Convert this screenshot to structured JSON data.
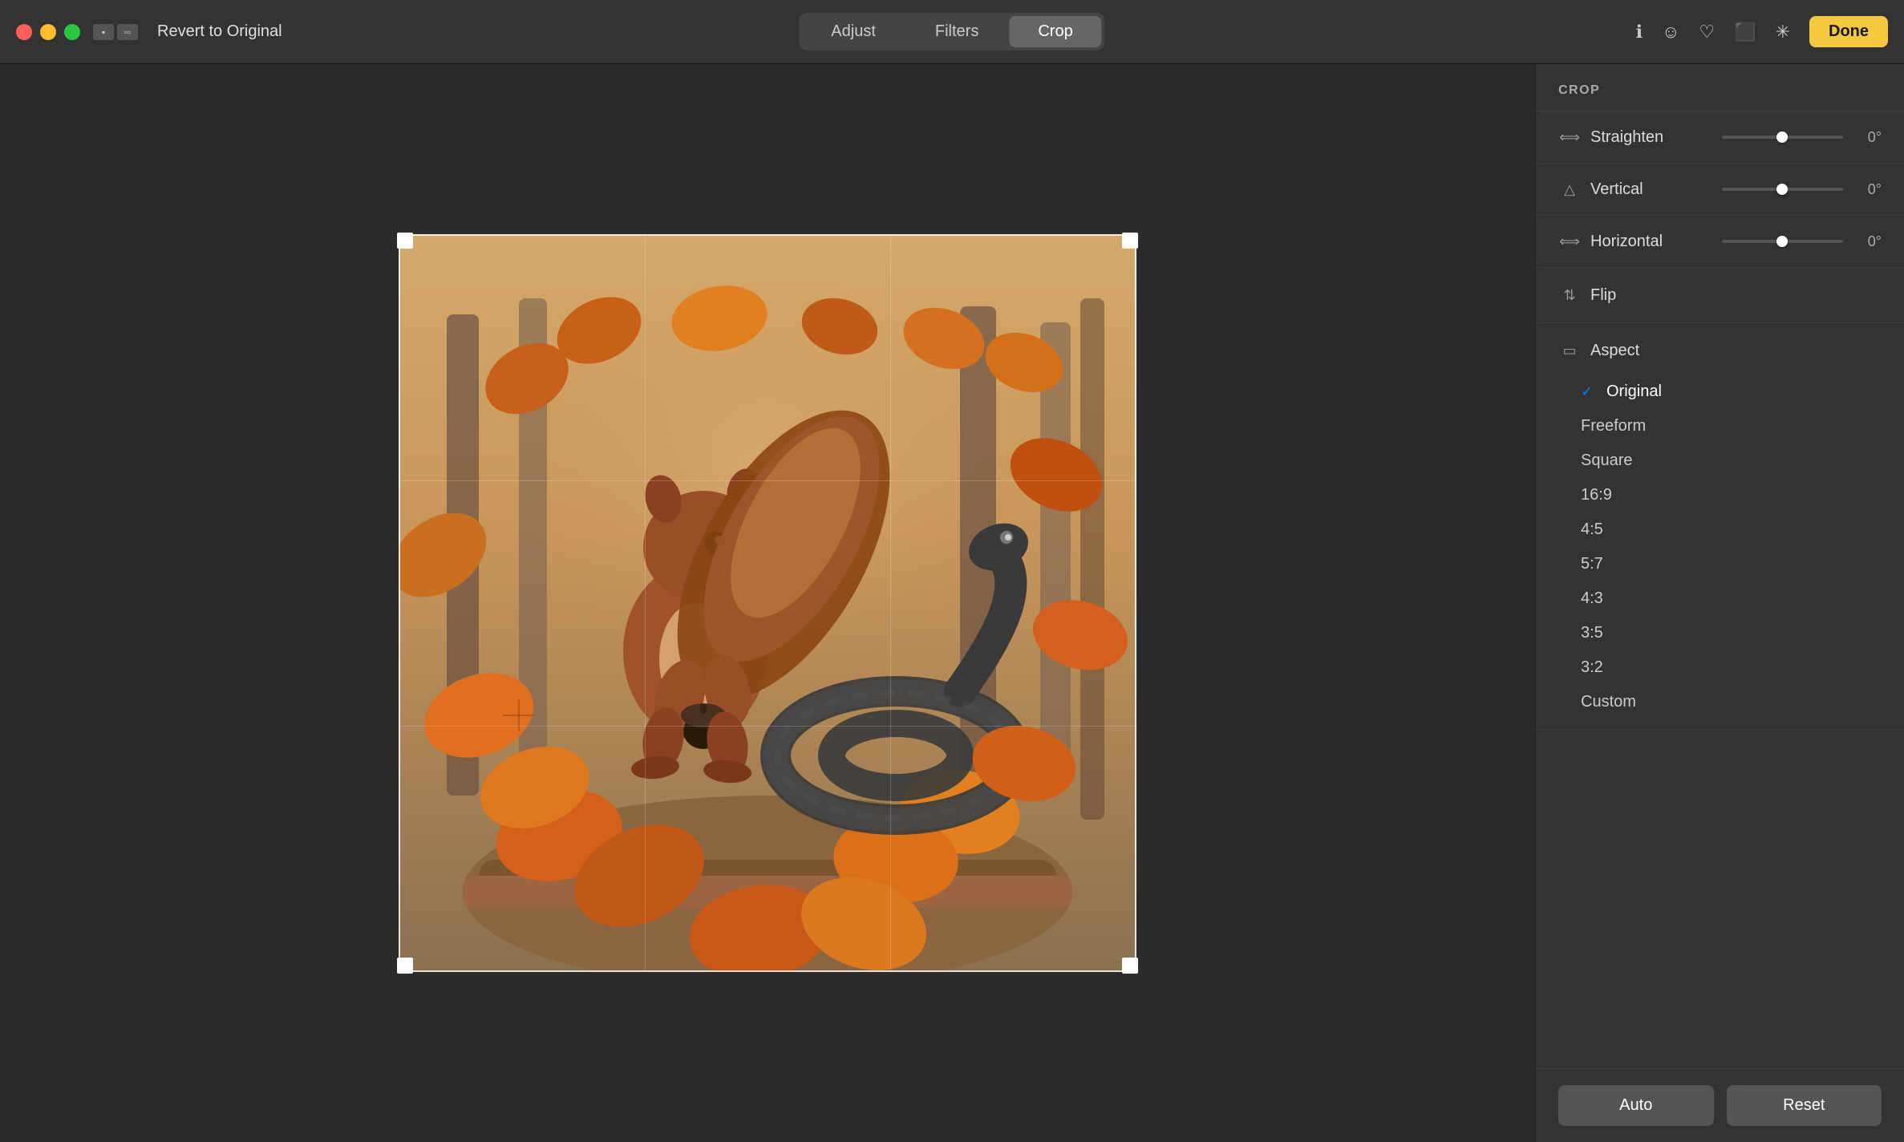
{
  "titlebar": {
    "revert_label": "Revert to Original",
    "tabs": [
      {
        "id": "adjust",
        "label": "Adjust",
        "active": false
      },
      {
        "id": "filters",
        "label": "Filters",
        "active": false
      },
      {
        "id": "crop",
        "label": "Crop",
        "active": true
      }
    ],
    "done_label": "Done"
  },
  "panel": {
    "title": "CROP",
    "controls": [
      {
        "id": "straighten",
        "label": "Straighten",
        "value": "0°"
      },
      {
        "id": "vertical",
        "label": "Vertical",
        "value": "0°"
      },
      {
        "id": "horizontal",
        "label": "Horizontal",
        "value": "0°"
      }
    ],
    "flip_label": "Flip",
    "aspect_label": "Aspect",
    "aspect_options": [
      {
        "id": "original",
        "label": "Original",
        "selected": true
      },
      {
        "id": "freeform",
        "label": "Freeform",
        "selected": false
      },
      {
        "id": "square",
        "label": "Square",
        "selected": false
      },
      {
        "id": "16-9",
        "label": "16:9",
        "selected": false
      },
      {
        "id": "4-5",
        "label": "4:5",
        "selected": false
      },
      {
        "id": "5-7",
        "label": "5:7",
        "selected": false
      },
      {
        "id": "4-3",
        "label": "4:3",
        "selected": false
      },
      {
        "id": "3-5",
        "label": "3:5",
        "selected": false
      },
      {
        "id": "3-2",
        "label": "3:2",
        "selected": false
      },
      {
        "id": "custom",
        "label": "Custom",
        "selected": false
      }
    ],
    "auto_label": "Auto",
    "reset_label": "Reset"
  }
}
